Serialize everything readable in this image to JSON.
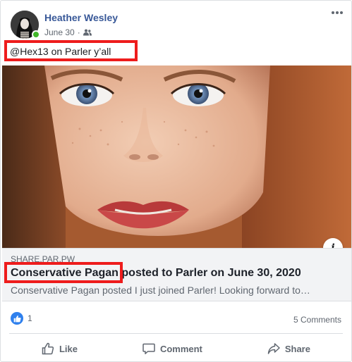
{
  "post": {
    "author": "Heather Wesley",
    "date": "June 30",
    "date_separator": "·",
    "audience_icon": "friends-icon",
    "text": "@Hex13 on Parler y’all"
  },
  "link_preview": {
    "domain": "SHARE.PAR.PW",
    "title_highlight": "Conservative Pagan",
    "title_rest": " posted to Parler on June 30, 2020",
    "description": "Conservative Pagan posted I just joined Parler! Looking forward to…",
    "info_label": "i"
  },
  "reactions": {
    "like_count": "1",
    "comments": "5 Comments"
  },
  "actions": {
    "like": "Like",
    "comment": "Comment",
    "share": "Share"
  },
  "colors": {
    "author_link": "#385898",
    "highlight_box": "#ee1c1c",
    "like_blue": "#2f80ed",
    "online_green": "#42b72a"
  }
}
